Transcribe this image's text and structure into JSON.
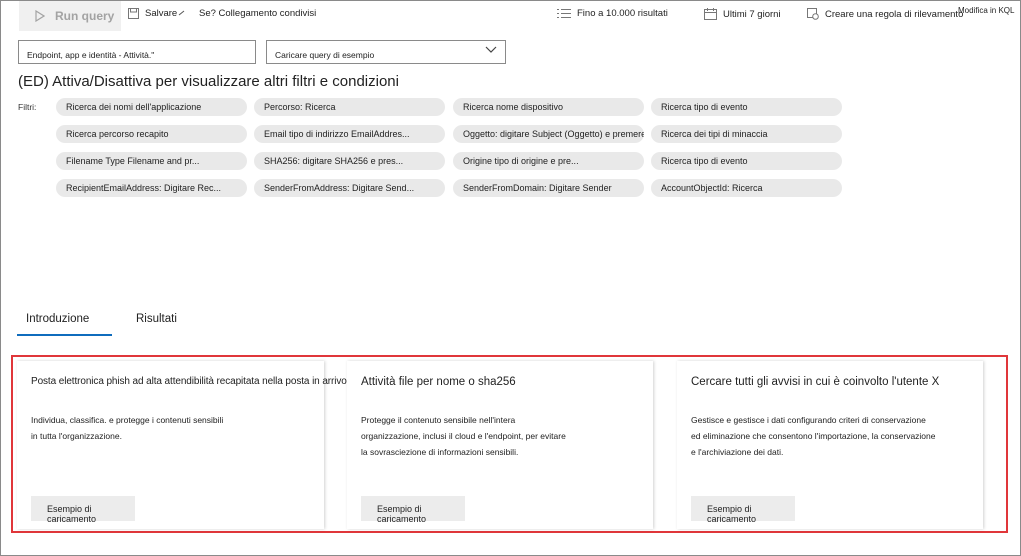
{
  "toolbar": {
    "run_query": "Run query",
    "save": "Salvare",
    "share_link": "Se? Collegamento condivisi",
    "results_limit": "Fino a 10.000 risultati",
    "time_range": "Ultimi 7 giorni",
    "detection_rule": "Creare una regola di rilevamento",
    "edit_kql": "Modifica in KQL"
  },
  "schema_select": {
    "value": "Endpoint, app e identità - Attività.\""
  },
  "sample_select": {
    "value": "Caricare query di esempio"
  },
  "toggle_title": "(ED) Attiva/Disattiva per visualizzare altri filtri e condizioni",
  "filters": {
    "label": "Filtri:",
    "chips": [
      "Ricerca dei nomi dell'applicazione",
      "Percorso: Ricerca",
      "Ricerca nome dispositivo",
      "Ricerca tipo di evento",
      "Ricerca percorso recapito",
      "Email tipo di indirizzo EmailAddres...",
      "Oggetto: digitare Subject (Oggetto) e premere",
      "Ricerca dei tipi di minaccia",
      "Filename Type Filename and pr...",
      "SHA256: digitare SHA256 e pres...",
      "Origine tipo di origine e pre...",
      "Ricerca tipo di evento",
      "RecipientEmailAddress: Digitare Rec...",
      "SenderFromAddress: Digitare Send...",
      "SenderFromDomain: Digitare Sender",
      "AccountObjectId: Ricerca"
    ]
  },
  "tabs": {
    "intro": "Introduzione",
    "results": "Risultati"
  },
  "cards": [
    {
      "title": "Posta elettronica phish ad alta attendibilità recapitata nella posta in arrivo",
      "desc": [
        "Individua, classifica. e protegge i contenuti sensibili",
        "in tutta l'organizzazione."
      ],
      "button": "Esempio di caricamento"
    },
    {
      "title": "Attività file per nome o sha256",
      "desc": [
        "Protegge il contenuto sensibile nell'intera",
        "organizzazione, inclusi il cloud e l'endpoint, per evitare",
        "la sovrasciezione di informazioni sensibili."
      ],
      "button": "Esempio di caricamento"
    },
    {
      "title": "Cercare tutti gli avvisi in cui è coinvolto l'utente X",
      "desc": [
        "Gestisce e gestisce i dati configurando criteri di conservazione",
        "ed eliminazione che consentono l'importazione, la conservazione",
        "e l'archiviazione dei dati."
      ],
      "button": "Esempio di caricamento"
    }
  ],
  "colors": {
    "accent": "#0f6cbd",
    "highlight": "#e0363a",
    "chip_bg": "#e9e9e9"
  }
}
